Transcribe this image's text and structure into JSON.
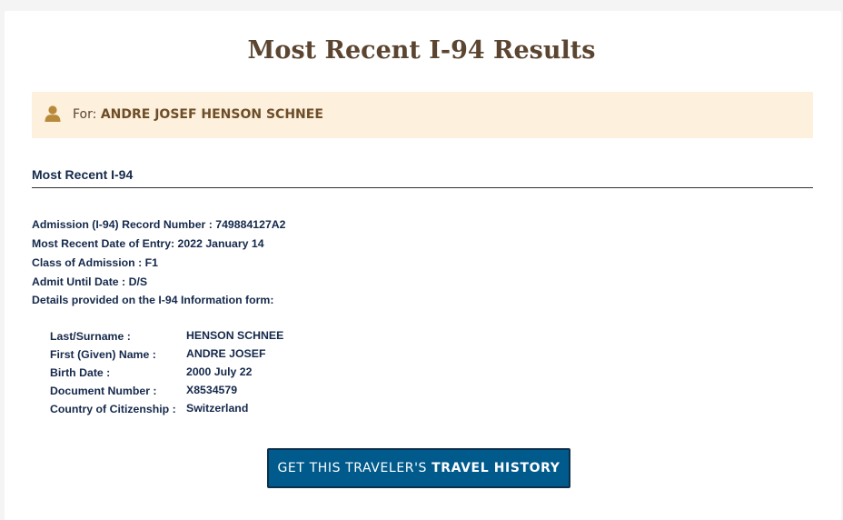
{
  "page": {
    "title": "Most Recent I-94 Results"
  },
  "traveler": {
    "for_label": "For:",
    "name": "ANDRE JOSEF HENSON SCHNEE",
    "icon": "user-icon"
  },
  "section": {
    "title": "Most Recent I-94"
  },
  "record": {
    "admission_number": "Admission (I-94) Record Number : 749884127A2",
    "entry_date": "Most Recent Date of Entry: 2022 January 14",
    "class_of_admission": "Class of Admission : F1",
    "admit_until": "Admit Until Date : D/S",
    "details_intro": "Details provided on the I-94 Information form:"
  },
  "details": [
    {
      "label": "Last/Surname :",
      "value": "HENSON SCHNEE"
    },
    {
      "label": "First (Given) Name :",
      "value": "ANDRE JOSEF"
    },
    {
      "label": "Birth Date :",
      "value": "2000 July 22"
    },
    {
      "label": "Document Number :",
      "value": "X8534579"
    },
    {
      "label": "Country of Citizenship :",
      "value": "Switzerland"
    }
  ],
  "actions": {
    "travel_history_prefix": "GET THIS TRAVELER'S",
    "travel_history_strong": "TRAVEL HISTORY"
  },
  "colors": {
    "title": "#5b4531",
    "banner_bg": "#fdf0dd",
    "icon": "#b8893a",
    "text": "#15294b",
    "button_bg": "#005a8c"
  }
}
